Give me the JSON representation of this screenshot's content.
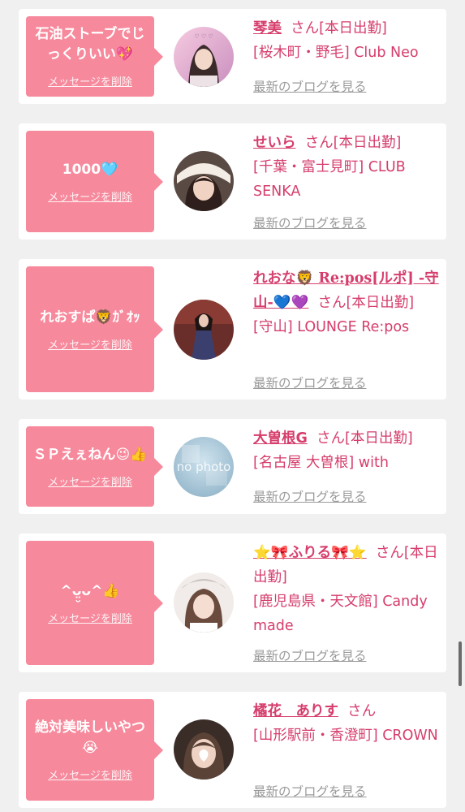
{
  "entries": [
    {
      "message": "石油ストーブでじっくりいい💖",
      "delete_label": "メッセージを削除",
      "name": "琴美",
      "san": "さん",
      "status": "[本日出勤]",
      "location": "[桜木町・野毛] Club Neo",
      "blog_label": "最新のブログを見る"
    },
    {
      "message": "1000🩵",
      "delete_label": "メッセージを削除",
      "name": "せいら",
      "san": "さん",
      "status": "[本日出勤]",
      "location": "[千葉・富士見町] CLUB SENKA",
      "blog_label": "最新のブログを見る"
    },
    {
      "message": "れおすぱ🦁ｶﾞｵｯ",
      "delete_label": "メッセージを削除",
      "name": "れおな🦁 Re:pos[ルポ] -守山-💙💜",
      "san": "さん",
      "status": "[本日出勤]",
      "location": "[守山] LOUNGE Re:pos",
      "blog_label": "最新のブログを見る"
    },
    {
      "message": "ＳＰえぇねん😉👍",
      "delete_label": "メッセージを削除",
      "name": "大曽根G",
      "san": "さん",
      "status": "[本日出勤]",
      "location": "[名古屋 大曽根] with",
      "blog_label": "最新のブログを見る",
      "avatar_text": "no photo"
    },
    {
      "message": "^ᴗ̤̮ᴗ^👍",
      "delete_label": "メッセージを削除",
      "name": "⭐🎀ふりる🎀⭐",
      "san": "さん",
      "status": "[本日出勤]",
      "location": "[鹿児島県・天文館] Candy made",
      "blog_label": "最新のブログを見る"
    },
    {
      "message": "絶対美味しいやつ😭",
      "delete_label": "メッセージを削除",
      "name": "橘花　ありす",
      "san": "さん",
      "status": "",
      "location": "[山形駅前・香澄町] CROWN",
      "blog_label": "最新のブログを見る"
    }
  ]
}
